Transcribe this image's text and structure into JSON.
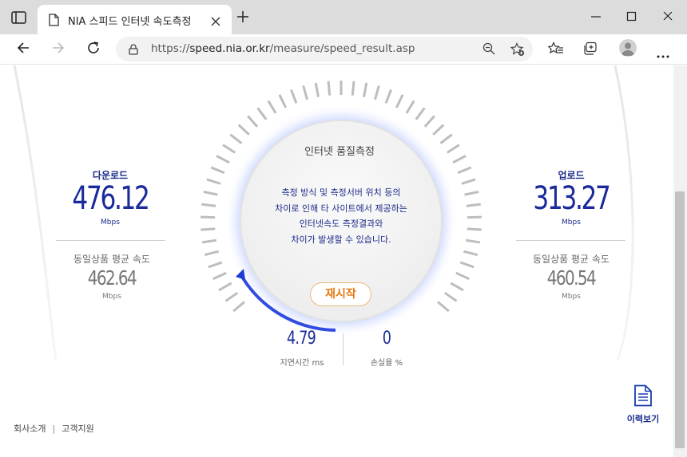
{
  "browser": {
    "tab_title": "NIA 스피드 인터넷 속도측정",
    "url_prefix": "https://",
    "url_host": "speed.nia.or.kr",
    "url_path": "/measure/speed_result.asp"
  },
  "download": {
    "label": "다운로드",
    "value": "476.12",
    "unit": "Mbps",
    "avg_label": "동일상품 평균 속도",
    "avg_value": "462.64",
    "avg_unit": "Mbps"
  },
  "upload": {
    "label": "업로드",
    "value": "313.27",
    "unit": "Mbps",
    "avg_label": "동일상품 평균 속도",
    "avg_value": "460.54",
    "avg_unit": "Mbps"
  },
  "center": {
    "title": "인터넷 품질측정",
    "message_lines": [
      "측정 방식 및 측정서버 위치 등의",
      "차이로 인해 타 사이트에서 제공하는",
      "인터넷속도 측정결과와",
      "차이가 발생할 수 있습니다."
    ],
    "restart_label": "재시작"
  },
  "latency": {
    "value": "4.79",
    "label": "지연시간 ms"
  },
  "loss": {
    "value": "0",
    "label": "손실율 %"
  },
  "history_label": "이력보기",
  "footer": {
    "company": "회사소개",
    "separator": "|",
    "support": "고객지원"
  },
  "colors": {
    "accent": "#1a2a9a",
    "restart": "#e67813",
    "gauge_glow": "#4a6cf7"
  },
  "icons": [
    "sidebar-icon",
    "page-icon",
    "close-icon",
    "plus-icon",
    "minimize-icon",
    "maximize-icon",
    "back-icon",
    "forward-icon",
    "refresh-icon",
    "lock-icon",
    "zoom-icon",
    "favorite-add-icon",
    "favorites-icon",
    "collections-icon",
    "profile-icon",
    "more-icon",
    "document-icon"
  ]
}
